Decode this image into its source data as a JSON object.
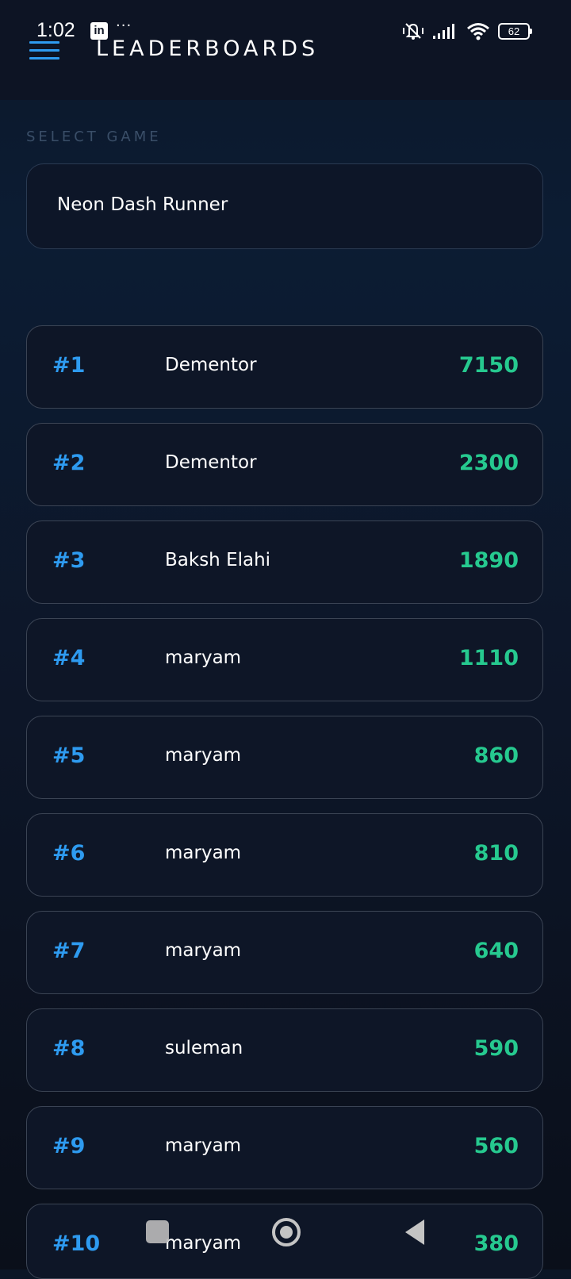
{
  "status": {
    "time": "1:02",
    "linkedin_icon": "linkedin-icon",
    "more": "···",
    "battery": "62"
  },
  "header": {
    "title": "LEADERBOARDS",
    "menu_icon": "hamburger-menu-icon",
    "accent_color": "#2e9bf0"
  },
  "game_select": {
    "label": "SELECT GAME",
    "value": "Neon Dash Runner"
  },
  "leaderboard": {
    "rank_color": "#2e9bf0",
    "score_color": "#26c98f",
    "rows": [
      {
        "rank": "#1",
        "name": "Dementor",
        "score": "7150"
      },
      {
        "rank": "#2",
        "name": "Dementor",
        "score": "2300"
      },
      {
        "rank": "#3",
        "name": "Baksh Elahi",
        "score": "1890"
      },
      {
        "rank": "#4",
        "name": "maryam",
        "score": "1110"
      },
      {
        "rank": "#5",
        "name": "maryam",
        "score": "860"
      },
      {
        "rank": "#6",
        "name": "maryam",
        "score": "810"
      },
      {
        "rank": "#7",
        "name": "maryam",
        "score": "640"
      },
      {
        "rank": "#8",
        "name": "suleman",
        "score": "590"
      },
      {
        "rank": "#9",
        "name": "maryam",
        "score": "560"
      },
      {
        "rank": "#10",
        "name": "maryam",
        "score": "380"
      }
    ]
  },
  "navbar": {
    "recents": "square-icon",
    "home": "circle-home-icon",
    "back": "triangle-back-icon"
  }
}
